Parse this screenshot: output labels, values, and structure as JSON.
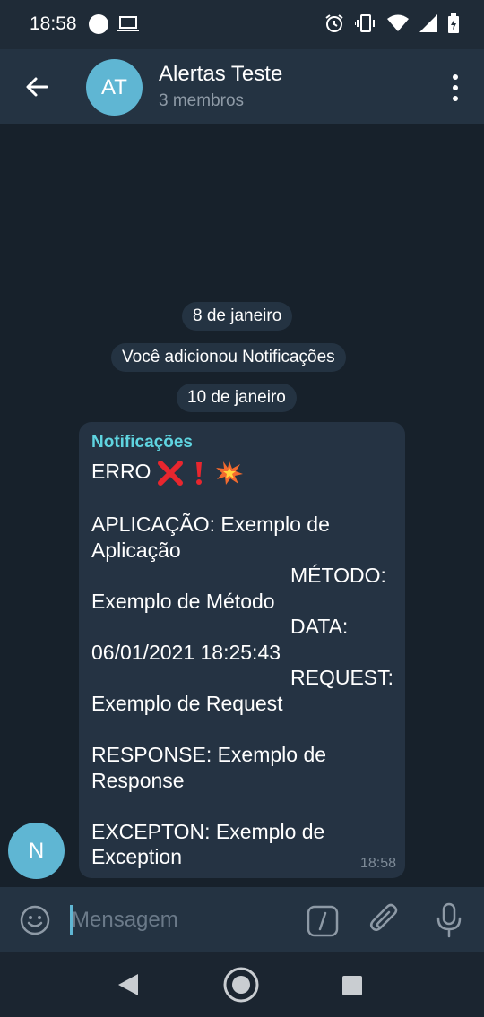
{
  "status_bar": {
    "time": "18:58"
  },
  "header": {
    "avatar_initials": "AT",
    "title": "Alertas Teste",
    "subtitle": "3 membros"
  },
  "chat": {
    "date_1": "8 de janeiro",
    "service_message": "Você adicionou Notificações",
    "date_2": "10 de janeiro",
    "message": {
      "sender": "Notificações",
      "sender_initial": "N",
      "line_error": "ERRO",
      "lines": [
        "APLICAÇÃO: Exemplo de",
        "Aplicação",
        "MÉTODO:",
        "Exemplo de Método",
        "DATA:",
        "06/01/2021 18:25:43",
        "REQUEST:",
        "Exemplo de Request",
        "RESPONSE: Exemplo de",
        "Response",
        "EXCEPTON: Exemplo de",
        "Exception"
      ],
      "time": "18:58"
    }
  },
  "input": {
    "placeholder": "Mensagem"
  },
  "colors": {
    "background": "#17212b",
    "header": "#243342",
    "bubble": "#253343",
    "sender_name": "#5fd4e0",
    "avatar": "#5fb6d3"
  },
  "icons": [
    "circle-icon",
    "laptop-icon",
    "alarm-icon",
    "vibrate-icon",
    "wifi-icon",
    "signal-icon",
    "battery-icon",
    "back-arrow-icon",
    "more-vertical-icon",
    "cross-mark-emoji",
    "exclamation-emoji",
    "collision-emoji",
    "smile-icon",
    "slash-command-icon",
    "paperclip-icon",
    "microphone-icon",
    "nav-back-icon",
    "nav-home-icon",
    "nav-recents-icon"
  ]
}
